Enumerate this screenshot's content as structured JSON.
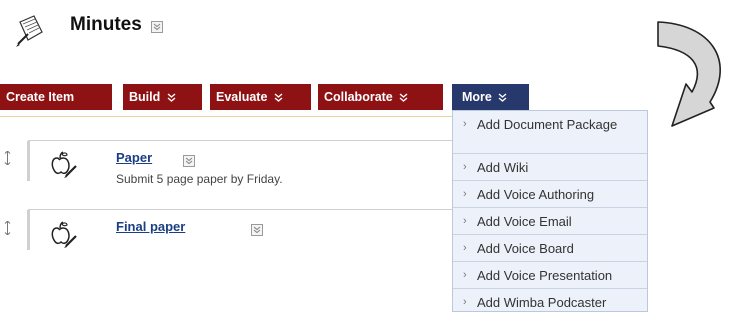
{
  "header": {
    "title": "Minutes",
    "icon": "scroll-pen-icon"
  },
  "toolbar": {
    "create_item": "Create Item",
    "build": "Build",
    "evaluate": "Evaluate",
    "collaborate": "Collaborate",
    "more": "More"
  },
  "colors": {
    "toolbar_red": "#8e1213",
    "toolbar_blue": "#27386d",
    "link_blue": "#1a3f84",
    "menu_bg": "#ecf1fa"
  },
  "items": [
    {
      "title": "Paper",
      "description": "Submit 5 page paper by Friday.",
      "icon": "apple-pencil-icon"
    },
    {
      "title": "Final paper",
      "description": "",
      "icon": "apple-pencil-icon"
    }
  ],
  "more_menu": {
    "items": [
      "Add Document Package",
      "Add Wiki",
      "Add Voice Authoring",
      "Add Voice Email",
      "Add Voice Board",
      "Add Voice Presentation",
      "Add Wimba Podcaster"
    ]
  },
  "annotation": {
    "icon": "curved-arrow-icon"
  }
}
